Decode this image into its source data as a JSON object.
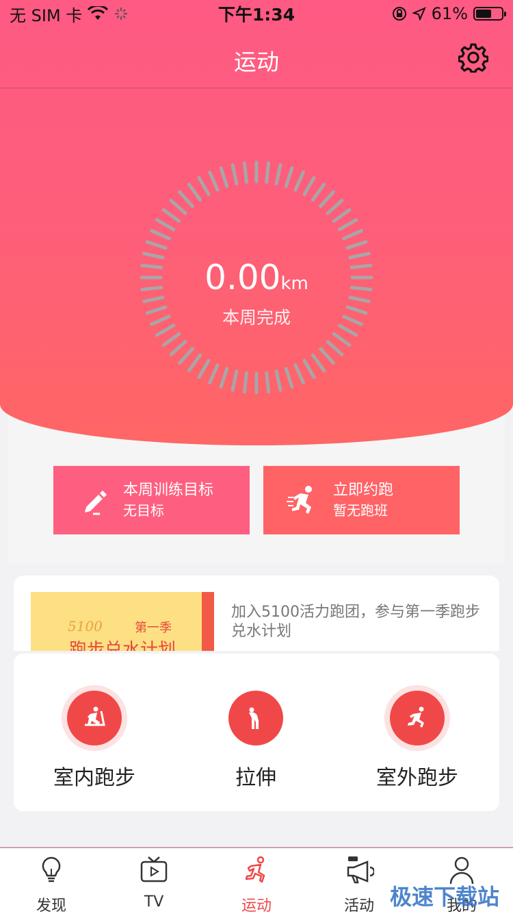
{
  "status": {
    "carrier": "无 SIM 卡",
    "time": "下午1:34",
    "battery": "61%",
    "battery_level": 0.61
  },
  "nav": {
    "title": "运动"
  },
  "weekly": {
    "distance": "0.00",
    "unit": "km",
    "label": "本周完成"
  },
  "actions": {
    "goal": {
      "title": "本周训练目标",
      "subtitle": "无目标"
    },
    "run": {
      "title": "立即约跑",
      "subtitle": "暂无跑班"
    }
  },
  "banner": {
    "logo": "5100",
    "season": "第一季",
    "headline": "跑步兑水计划",
    "text": "加入5100活力跑团，参与第一季跑步兑水计划"
  },
  "modes": [
    {
      "label": "室内跑步",
      "icon": "treadmill-icon"
    },
    {
      "label": "拉伸",
      "icon": "stretch-icon"
    },
    {
      "label": "室外跑步",
      "icon": "runner-icon"
    }
  ],
  "tabs": [
    {
      "label": "发现",
      "icon": "lightbulb-icon"
    },
    {
      "label": "TV",
      "icon": "tv-icon"
    },
    {
      "label": "运动",
      "icon": "running-icon",
      "active": true
    },
    {
      "label": "活动",
      "icon": "megaphone-icon"
    },
    {
      "label": "我的",
      "icon": "user-icon"
    }
  ],
  "watermark": "极速下载站",
  "colors": {
    "accent": "#fe5a84",
    "active": "#f04848",
    "run_button": "#ff6366"
  }
}
